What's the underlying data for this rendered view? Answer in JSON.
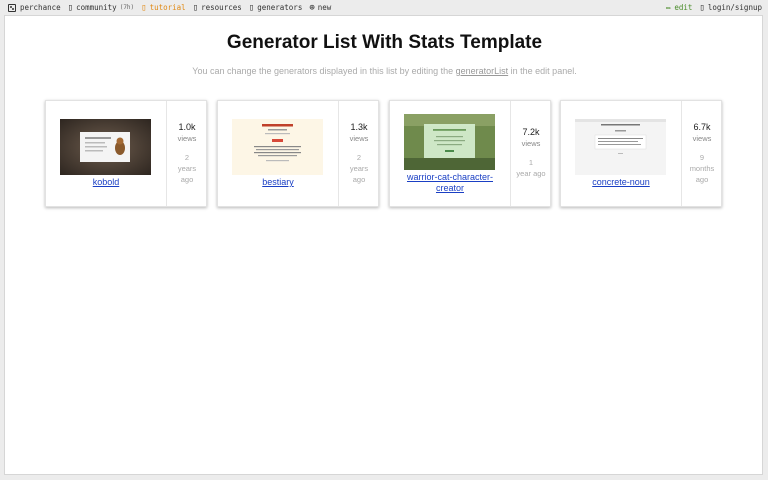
{
  "nav": {
    "brand": "perchance",
    "community": "community",
    "community_count": "(7h)",
    "tutorial": "tutorial",
    "resources": "resources",
    "generators": "generators",
    "new": "new",
    "edit": "edit",
    "login": "login/signup"
  },
  "page": {
    "title": "Generator List With Stats Template",
    "subtitle_before": "You can change the generators displayed in this list by editing the ",
    "subtitle_link": "generatorList",
    "subtitle_after": " in the edit panel."
  },
  "cards": [
    {
      "name": "kobold",
      "views": "1.0k",
      "views_label": "views",
      "age": [
        "2",
        "years",
        "ago"
      ]
    },
    {
      "name": "bestiary",
      "views": "1.3k",
      "views_label": "views",
      "age": [
        "2",
        "years",
        "ago"
      ]
    },
    {
      "name": "warrior-cat-character-creator",
      "name_lines": [
        "warrior-cat-character-",
        "creator"
      ],
      "views": "7.2k",
      "views_label": "views",
      "age": [
        "1",
        "year ago"
      ]
    },
    {
      "name": "concrete-noun",
      "views": "6.7k",
      "views_label": "views",
      "age": [
        "9",
        "months",
        "ago"
      ]
    }
  ],
  "colors": {
    "accent": "#e08a16",
    "link": "#1a3fc4",
    "edit": "#4a8c2a"
  }
}
